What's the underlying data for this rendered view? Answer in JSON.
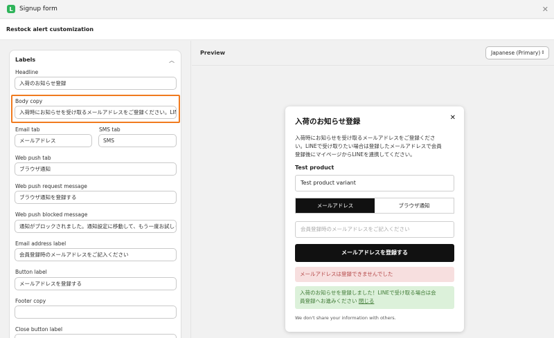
{
  "window": {
    "title": "Signup form",
    "logo": "L"
  },
  "subheader": {
    "title": "Restock alert customization"
  },
  "labels_card": {
    "title": "Labels",
    "fields": {
      "headline": {
        "label": "Headline",
        "value": "入荷のお知らせ登録"
      },
      "body_copy": {
        "label": "Body copy",
        "value": "入荷時にお知らせを受け取るメールアドレスをご登録ください。LINEで受け取りたい場合は"
      },
      "email_tab": {
        "label": "Email tab",
        "value": "メールアドレス"
      },
      "sms_tab": {
        "label": "SMS tab",
        "value": "SMS"
      },
      "web_push_tab": {
        "label": "Web push tab",
        "value": "ブラウザ通知"
      },
      "web_push_request": {
        "label": "Web push request message",
        "value": "ブラウザ通知を登録する"
      },
      "web_push_blocked": {
        "label": "Web push blocked message",
        "value": "通知がブロックされました。通知設定に移動して、もう一度お試しください。"
      },
      "email_address": {
        "label": "Email address label",
        "value": "会員登録時のメールアドレスをご記入ください"
      },
      "button": {
        "label": "Button label",
        "value": "メールアドレスを登録する"
      },
      "footer_copy": {
        "label": "Footer copy",
        "value": ""
      },
      "close_button": {
        "label": "Close button label",
        "value": ""
      }
    }
  },
  "preview": {
    "title": "Preview",
    "language": "Japanese (Primary)",
    "modal": {
      "title": "入荷のお知らせ登録",
      "body_line1": "入荷時にお知らせを受け取るメールアドレスをご登録くださ",
      "body_line2": "い。LINEで受け取りたい場合は登録したメールアドレスで会員",
      "body_line3": "登録後にマイページからLINEを連携してください。",
      "product": "Test product",
      "variant": "Test product variant",
      "tab_email": "メールアドレス",
      "tab_browser": "ブラウザ通知",
      "email_placeholder": "会員登録時のメールアドレスをご記入ください",
      "button": "メールアドレスを登録する",
      "error": "メールアドレスは登録できませんでした",
      "success_line1": "入荷のお知らせを登録しました！LINEで受け取る場合は会",
      "success_line2": "員登録へお進みください",
      "success_link": "閉じる",
      "footer": "We don't share your information with others."
    }
  },
  "colors": {
    "accent_highlight": "#f07a1e",
    "brand_green": "#2fb45a",
    "error_bg": "#f7dfdf",
    "success_bg": "#dcf1da"
  }
}
